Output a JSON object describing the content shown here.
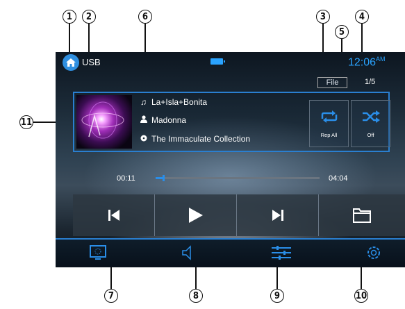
{
  "callouts": [
    "1",
    "2",
    "3",
    "4",
    "5",
    "6",
    "7",
    "8",
    "9",
    "10",
    "11"
  ],
  "topbar": {
    "source": "USB",
    "clock": "12:06",
    "clock_ampm": "AM"
  },
  "file_button": "File",
  "track_counter": "1/5",
  "song": {
    "title": "La+Isla+Bonita",
    "artist": "Madonna",
    "album": "The Immaculate Collection"
  },
  "repeat_button": {
    "label": "Rep All"
  },
  "shuffle_button": {
    "label": "Off"
  },
  "progress": {
    "elapsed": "00:11",
    "total": "04:04",
    "fraction": 0.045
  },
  "icons": {
    "home": "home-icon",
    "battery": "battery-icon",
    "note": "music-note-icon",
    "person": "artist-icon",
    "disc": "disc-icon",
    "repeat": "repeat-icon",
    "shuffle": "shuffle-icon",
    "prev": "previous-track-icon",
    "play": "play-icon",
    "next": "next-track-icon",
    "folder": "folder-icon",
    "display": "display-icon",
    "volume": "volume-icon",
    "eq": "equalizer-icon",
    "settings": "settings-icon"
  },
  "colors": {
    "accent": "#2a8ee8",
    "clock": "#2aa3ff",
    "home_circle": "#2f8fe0"
  }
}
